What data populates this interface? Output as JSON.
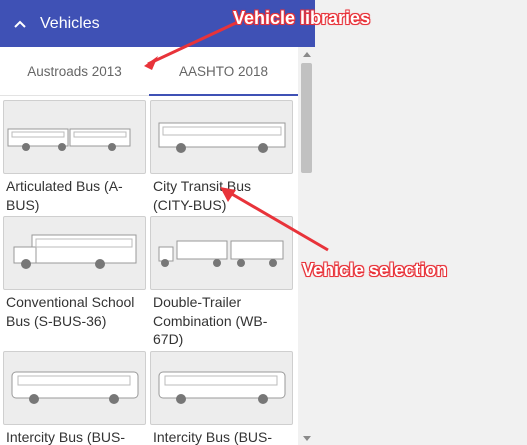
{
  "panel": {
    "title": "Vehicles"
  },
  "tabs": [
    {
      "label": "Austroads 2013",
      "active": false
    },
    {
      "label": "AASHTO 2018",
      "active": true
    }
  ],
  "vehicles": [
    {
      "name": "Articulated Bus (A-BUS)",
      "icon": "articulated-bus-icon"
    },
    {
      "name": "City Transit Bus (CITY-BUS)",
      "icon": "city-bus-icon"
    },
    {
      "name": "Conventional School Bus (S-BUS-36)",
      "icon": "school-bus-icon"
    },
    {
      "name": "Double-Trailer Combination (WB-67D)",
      "icon": "double-trailer-icon"
    },
    {
      "name": "Intercity Bus (BUS-",
      "icon": "intercity-bus-icon"
    },
    {
      "name": "Intercity Bus (BUS-",
      "icon": "intercity-bus-icon"
    }
  ],
  "annotations": {
    "libraries": "Vehicle libraries",
    "selection": "Vehicle selection"
  },
  "colors": {
    "header": "#3f51b5",
    "annotation": "#e8333a"
  }
}
